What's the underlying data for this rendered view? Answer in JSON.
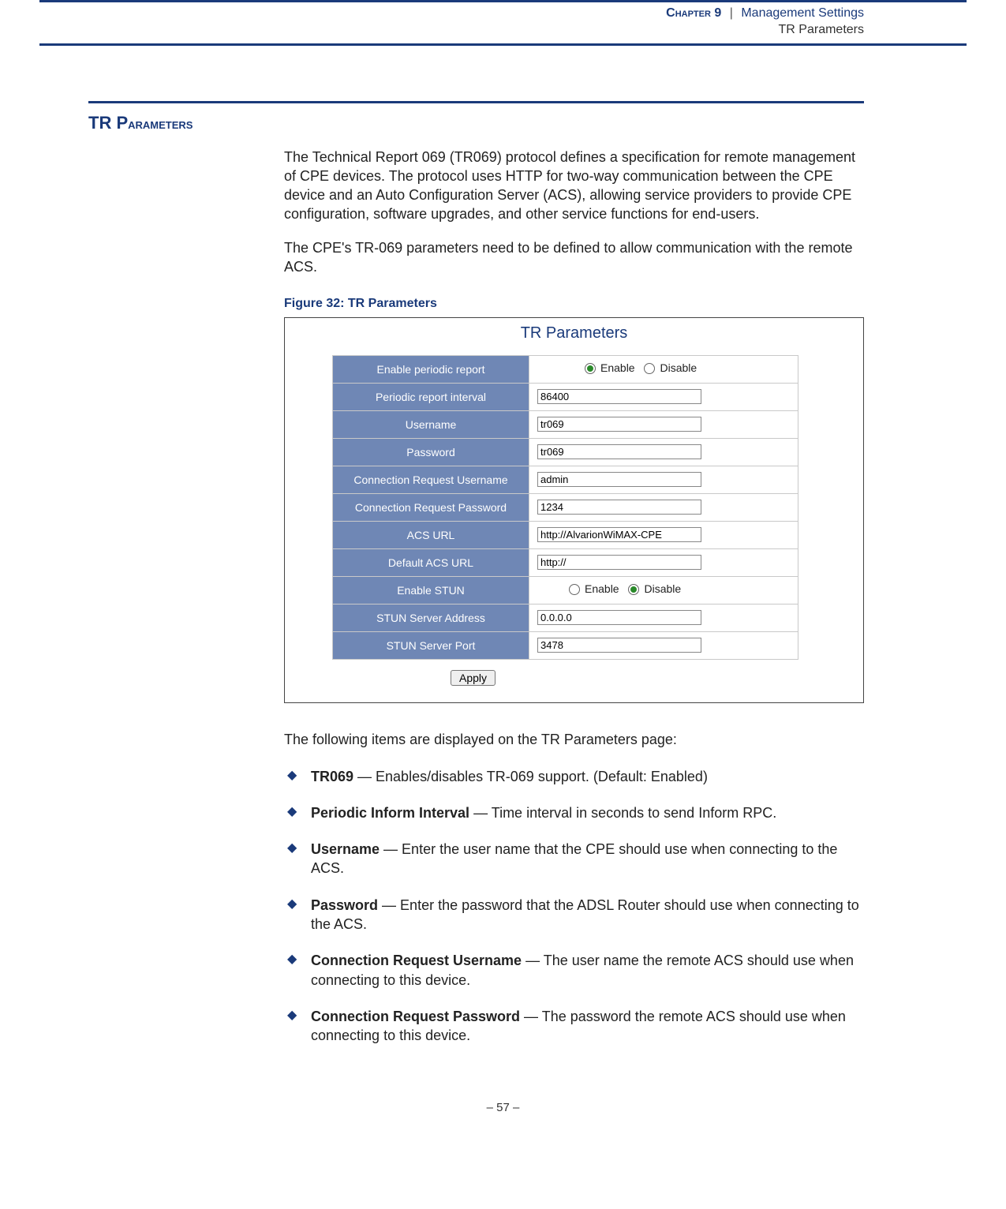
{
  "header": {
    "chapter": "Chapter 9",
    "section": "Management Settings",
    "subsection": "TR Parameters"
  },
  "section_title_lead": "TR P",
  "section_title_rest": "arameters",
  "para1": "The Technical Report 069 (TR069) protocol defines a specification for remote management of CPE devices. The protocol uses HTTP for two-way communication between the CPE device and an Auto Configuration Server (ACS), allowing service providers to provide CPE configuration, software upgrades, and other service functions for end-users.",
  "para2": "The CPE's TR-069 parameters need to be defined to allow communication with the remote ACS.",
  "figure": {
    "caption": "Figure 32:  TR Parameters",
    "title": "TR Parameters",
    "radio_labels": {
      "enable": "Enable",
      "disable": "Disable"
    },
    "rows": [
      {
        "label": "Enable periodic report",
        "type": "radio",
        "selected": "enable"
      },
      {
        "label": "Periodic report interval",
        "type": "text",
        "value": "86400"
      },
      {
        "label": "Username",
        "type": "text",
        "value": "tr069"
      },
      {
        "label": "Password",
        "type": "text",
        "value": "tr069"
      },
      {
        "label": "Connection Request Username",
        "type": "text",
        "value": "admin"
      },
      {
        "label": "Connection Request Password",
        "type": "text",
        "value": "1234"
      },
      {
        "label": "ACS URL",
        "type": "text",
        "value": "http://AlvarionWiMAX-CPE"
      },
      {
        "label": "Default ACS URL",
        "type": "text",
        "value": "http://"
      },
      {
        "label": "Enable STUN",
        "type": "radio",
        "selected": "disable"
      },
      {
        "label": "STUN Server Address",
        "type": "text",
        "value": "0.0.0.0"
      },
      {
        "label": "STUN Server Port",
        "type": "text",
        "value": "3478"
      }
    ],
    "apply_label": "Apply"
  },
  "list_intro": "The following items are displayed on the TR Parameters page:",
  "items": [
    {
      "term": "TR069",
      "desc": " — Enables/disables TR-069 support. (Default: Enabled)"
    },
    {
      "term": "Periodic Inform Interval",
      "desc": " — Time interval in seconds to send Inform RPC."
    },
    {
      "term": "Username",
      "desc": " — Enter the user name that the CPE should use when connecting to the ACS."
    },
    {
      "term": "Password",
      "desc": " — Enter the password that the ADSL Router should use when connecting to the ACS."
    },
    {
      "term": "Connection Request Username",
      "desc": " — The user name the remote ACS should use when connecting to this device."
    },
    {
      "term": "Connection Request Password",
      "desc": " — The password the remote ACS should use when connecting to this device."
    }
  ],
  "page_number": "–  57  –"
}
